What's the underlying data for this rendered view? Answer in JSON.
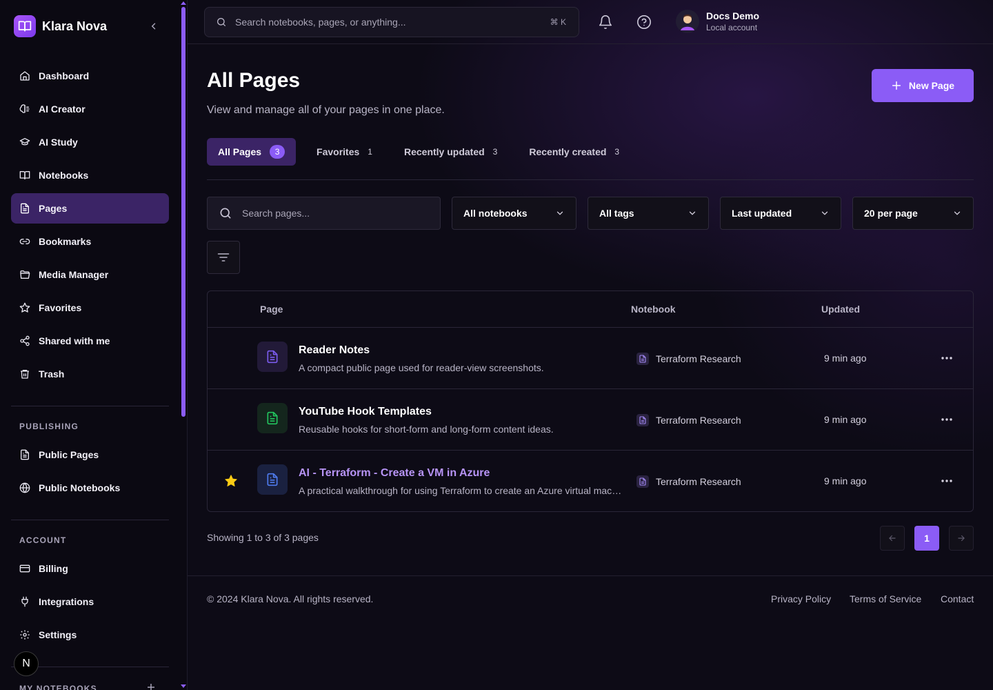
{
  "app": {
    "name": "Klara Nova"
  },
  "sidebar": {
    "items": [
      {
        "label": "Dashboard",
        "icon": "home-icon"
      },
      {
        "label": "AI Creator",
        "icon": "ai-creator-icon"
      },
      {
        "label": "AI Study",
        "icon": "graduation-cap-icon"
      },
      {
        "label": "Notebooks",
        "icon": "book-open-icon"
      },
      {
        "label": "Pages",
        "icon": "file-text-icon",
        "active": true
      },
      {
        "label": "Bookmarks",
        "icon": "link-icon"
      },
      {
        "label": "Media Manager",
        "icon": "folder-open-icon"
      },
      {
        "label": "Favorites",
        "icon": "star-icon"
      },
      {
        "label": "Shared with me",
        "icon": "share-icon"
      },
      {
        "label": "Trash",
        "icon": "trash-icon"
      }
    ],
    "publishing_label": "PUBLISHING",
    "publishing": [
      {
        "label": "Public Pages",
        "icon": "file-text-icon"
      },
      {
        "label": "Public Notebooks",
        "icon": "globe-icon"
      }
    ],
    "account_label": "ACCOUNT",
    "account": [
      {
        "label": "Billing",
        "icon": "credit-card-icon"
      },
      {
        "label": "Integrations",
        "icon": "plug-icon"
      },
      {
        "label": "Settings",
        "icon": "gear-icon"
      }
    ],
    "notebooks_label": "MY NOTEBOOKS",
    "next_badge": "N"
  },
  "topbar": {
    "search_placeholder": "Search notebooks, pages, or anything...",
    "shortcut": "⌘ K",
    "user_name": "Docs Demo",
    "user_sub": "Local account"
  },
  "header": {
    "title": "All Pages",
    "subtitle": "View and manage all of your pages in one place.",
    "new_button": "New Page"
  },
  "tabs": [
    {
      "label": "All Pages",
      "count": "3",
      "active": true
    },
    {
      "label": "Favorites",
      "count": "1"
    },
    {
      "label": "Recently updated",
      "count": "3"
    },
    {
      "label": "Recently created",
      "count": "3"
    }
  ],
  "filters": {
    "search_placeholder": "Search pages...",
    "notebook": "All notebooks",
    "tags": "All tags",
    "sort": "Last updated",
    "per_page": "20 per page"
  },
  "table": {
    "columns": [
      "Page",
      "Notebook",
      "Updated"
    ],
    "rows": [
      {
        "title": "Reader Notes",
        "desc": "A compact public page used for reader-view screenshots.",
        "notebook": "Terraform Research",
        "updated": "9 min ago",
        "favorite": false,
        "color": "#7c5cf0",
        "bg": "#221a38"
      },
      {
        "title": "YouTube Hook Templates",
        "desc": "Reusable hooks for short-form and long-form content ideas.",
        "notebook": "Terraform Research",
        "updated": "9 min ago",
        "favorite": false,
        "color": "#22c55e",
        "bg": "#14261d"
      },
      {
        "title": "AI - Terraform - Create a VM in Azure",
        "desc": "A practical walkthrough for using Terraform to create an Azure virtual machine",
        "notebook": "Terraform Research",
        "updated": "9 min ago",
        "favorite": true,
        "color": "#4f7cf0",
        "bg": "#1a2140"
      }
    ]
  },
  "pagination": {
    "showing": "Showing 1 to 3 of 3 pages",
    "current": "1"
  },
  "footer": {
    "copyright": "© 2024 Klara Nova. All rights reserved.",
    "links": [
      "Privacy Policy",
      "Terms of Service",
      "Contact"
    ]
  },
  "colors": {
    "accent": "#8b5cf6",
    "active_bg": "#3b2466",
    "star": "#facc15"
  }
}
